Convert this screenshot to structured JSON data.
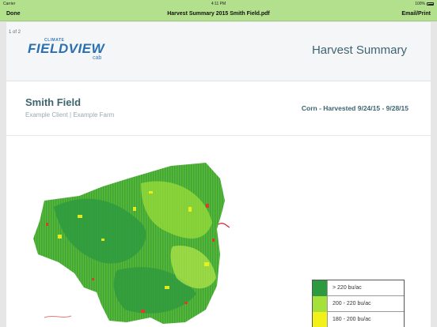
{
  "status_bar": {
    "carrier": "Carrier",
    "time": "4:11 PM",
    "battery": "100%"
  },
  "nav": {
    "done": "Done",
    "title": "Harvest Summary 2015 Smith Field.pdf",
    "email_print": "Email/Print"
  },
  "page_indicator": "1 of 2",
  "logo": {
    "climate": "CLIMATE",
    "fieldview": "FIELDVIEW",
    "cab": "cab"
  },
  "report_title": "Harvest Summary",
  "field": {
    "name": "Smith Field",
    "client_farm": "Example Client | Example Farm",
    "crop_info": "Corn - Harvested 9/24/15 - 9/28/15"
  },
  "legend": [
    {
      "label": "> 220 bu/ac",
      "color": "#2e9a3f"
    },
    {
      "label": "200 - 220 bu/ac",
      "color": "#a6e03a"
    },
    {
      "label": "180 - 200 bu/ac",
      "color": "#f2f21a"
    }
  ],
  "colors": {
    "nav_bg": "#b2e08c",
    "title_text": "#3e6470",
    "map_dark": "#2e9a3f",
    "map_light": "#7ed321",
    "map_yellow": "#f2f21a",
    "map_red": "#e03a2a"
  }
}
